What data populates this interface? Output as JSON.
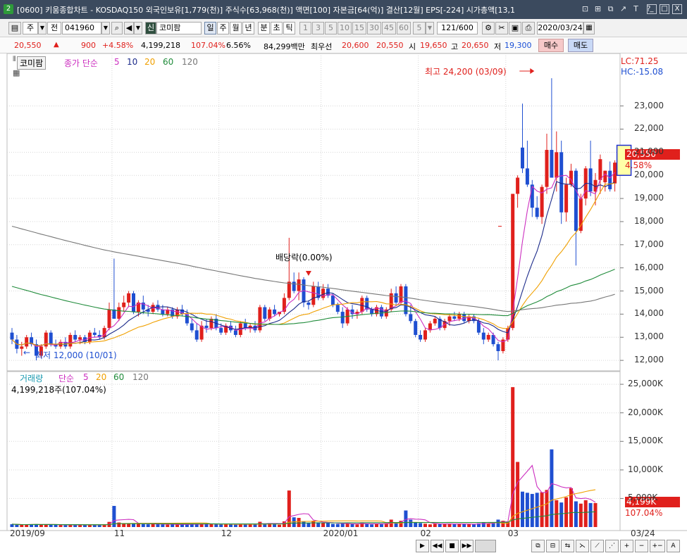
{
  "window": {
    "badge": "2",
    "title": "[0600] 키움종합차트 - KOSDAQ150 외국인보유[1,779(천)] 주식수[63,968(천)] 액면[100] 자본금[64(억)] 결산[12월] EPS[-224] 시가총액[13,1",
    "controls": [
      "⊡",
      "⊞",
      "⧉",
      "↗",
      "T",
      "?"
    ],
    "window_buttons": [
      "_",
      "□",
      "X"
    ]
  },
  "toolbar": {
    "period_unit": "주",
    "prev_label": "전",
    "code": "041960",
    "badge_sin": "신",
    "stock_name": "코미팜",
    "tabs": [
      "일",
      "주",
      "월",
      "년",
      "분",
      "초",
      "틱"
    ],
    "selected_tab": "일",
    "intervals": [
      "1",
      "3",
      "5",
      "10",
      "15",
      "30",
      "45",
      "60"
    ],
    "interval_value": "5",
    "count": "121/600",
    "date": "2020/03/24"
  },
  "infobar": {
    "price": "20,550",
    "change": "900",
    "change_pct": "+4.58%",
    "volume": "4,199,218",
    "volume_ratio": "107.04%",
    "turnover": "6.56%",
    "amount": "84,299백만",
    "best_quote_label": "최우선",
    "best_ask": "20,600",
    "best_bid": "20,550",
    "open_label": "시",
    "open": "19,650",
    "high_label": "고",
    "high": "20,650",
    "low_label": "저",
    "low": "19,300",
    "buy_button": "매수",
    "sell_button": "매도"
  },
  "legend": {
    "stock_tag": "코미팜",
    "price_label": "종가 단순",
    "ma": [
      "5",
      "10",
      "20",
      "60",
      "120"
    ],
    "volume_label": "거래량",
    "volume_ma_label": "단순",
    "vol_ma": [
      "5",
      "20",
      "60",
      "120"
    ],
    "volume_now": "4,199,218주(107.04%)"
  },
  "colors": {
    "up": "#e0201c",
    "down": "#1f4fd1",
    "ma5": "#cc2fc0",
    "ma10": "#1b2a8a",
    "ma20": "#f0a000",
    "ma60": "#1f8b3a",
    "ma120": "#777777",
    "ma_long": "#555555"
  },
  "annotations": {
    "high_note": "최고 24,200 (03/09)",
    "low_note": "최저 12,000 (10/01)",
    "dividend_note": "배당락(0.00%)",
    "lc": "LC:71.25",
    "hc": "HC:-15.08",
    "price_tag": "20,550",
    "pct_tag": "4.58%",
    "vol_tag": "4,199K",
    "vol_pct_tag": "107.04%"
  },
  "chart_data": {
    "type": "candlestick",
    "date_ticks": [
      "2019/09",
      "11",
      "12",
      "2020/01",
      "02",
      "03",
      "03/24"
    ],
    "price_axis": [
      "23,000",
      "22,000",
      "21,000",
      "20,000",
      "19,000",
      "18,000",
      "17,000",
      "16,000",
      "15,000",
      "14,000",
      "13,000",
      "12,000"
    ],
    "volume_axis": [
      "25,000K",
      "20,000K",
      "15,000K",
      "10,000K",
      "5,000K"
    ],
    "price_range": [
      11700,
      24600
    ],
    "volume_range": [
      0,
      26000
    ],
    "candles": [
      [
        13200,
        13400,
        12700,
        12900
      ],
      [
        12900,
        13100,
        12300,
        12500
      ],
      [
        12500,
        12800,
        12200,
        12600
      ],
      [
        12600,
        13100,
        12500,
        13000
      ],
      [
        13000,
        13200,
        12600,
        12700
      ],
      [
        12700,
        12900,
        12000,
        12200
      ],
      [
        12200,
        12700,
        12100,
        12600
      ],
      [
        12600,
        13300,
        12500,
        13200
      ],
      [
        13200,
        13300,
        12600,
        12700
      ],
      [
        12700,
        12900,
        12500,
        12600
      ],
      [
        12600,
        12900,
        12500,
        12800
      ],
      [
        12800,
        13000,
        12500,
        12600
      ],
      [
        12600,
        13200,
        12500,
        13100
      ],
      [
        13100,
        13300,
        12800,
        12900
      ],
      [
        12900,
        13100,
        12700,
        13000
      ],
      [
        13000,
        13100,
        12700,
        12800
      ],
      [
        12800,
        13300,
        12700,
        13200
      ],
      [
        13200,
        13400,
        13000,
        13100
      ],
      [
        13100,
        13300,
        12900,
        13000
      ],
      [
        13000,
        13500,
        12900,
        13400
      ],
      [
        13400,
        14500,
        13300,
        14200
      ],
      [
        14200,
        16400,
        13800,
        13800
      ],
      [
        13800,
        14500,
        13700,
        14300
      ],
      [
        14300,
        14800,
        14100,
        14500
      ],
      [
        14500,
        15000,
        14300,
        14900
      ],
      [
        14900,
        15000,
        14000,
        14100
      ],
      [
        14100,
        14600,
        13900,
        14500
      ],
      [
        14500,
        14800,
        14000,
        14200
      ],
      [
        14200,
        14400,
        13900,
        14100
      ],
      [
        14100,
        14500,
        14000,
        14400
      ],
      [
        14400,
        14600,
        14100,
        14200
      ],
      [
        14200,
        14400,
        13900,
        14000
      ],
      [
        14000,
        14300,
        13900,
        14200
      ],
      [
        14200,
        14300,
        13800,
        13900
      ],
      [
        13900,
        14300,
        13800,
        14200
      ],
      [
        14200,
        14400,
        13900,
        14000
      ],
      [
        14000,
        14200,
        13500,
        13600
      ],
      [
        13600,
        13800,
        13200,
        13300
      ],
      [
        13300,
        13600,
        12800,
        12900
      ],
      [
        12900,
        13700,
        12800,
        13500
      ],
      [
        13500,
        13800,
        13200,
        13400
      ],
      [
        13400,
        13900,
        13300,
        13800
      ],
      [
        13800,
        14000,
        13300,
        13400
      ],
      [
        13400,
        13600,
        13100,
        13200
      ],
      [
        13200,
        13600,
        13100,
        13500
      ],
      [
        13500,
        13700,
        13200,
        13300
      ],
      [
        13300,
        13500,
        13000,
        13100
      ],
      [
        13100,
        13700,
        13000,
        13600
      ],
      [
        13600,
        13800,
        13300,
        13400
      ],
      [
        13400,
        13600,
        13200,
        13500
      ],
      [
        13500,
        13700,
        13200,
        13300
      ],
      [
        13300,
        14400,
        13200,
        14300
      ],
      [
        14300,
        14400,
        13700,
        13800
      ],
      [
        13800,
        14300,
        13700,
        14200
      ],
      [
        14200,
        14400,
        13900,
        14000
      ],
      [
        14000,
        14100,
        13900,
        14100
      ],
      [
        14100,
        14900,
        14000,
        14700
      ],
      [
        14700,
        17300,
        14600,
        15400
      ],
      [
        15400,
        15800,
        14900,
        15000
      ],
      [
        15000,
        15800,
        14600,
        15500
      ],
      [
        15500,
        15600,
        14300,
        14500
      ],
      [
        14500,
        14600,
        14200,
        14400
      ],
      [
        14400,
        15400,
        14300,
        15200
      ],
      [
        15200,
        15400,
        14600,
        14700
      ],
      [
        14700,
        15300,
        14600,
        15100
      ],
      [
        15100,
        15300,
        14700,
        14800
      ],
      [
        14800,
        14900,
        14300,
        14400
      ],
      [
        14400,
        14500,
        14000,
        14100
      ],
      [
        14100,
        14300,
        13400,
        13600
      ],
      [
        13600,
        14300,
        13500,
        14200
      ],
      [
        14200,
        14400,
        13800,
        14000
      ],
      [
        14000,
        14200,
        13800,
        14100
      ],
      [
        14100,
        14800,
        14000,
        14700
      ],
      [
        14700,
        14800,
        14100,
        14200
      ],
      [
        14200,
        14300,
        13900,
        14000
      ],
      [
        14000,
        14400,
        13900,
        14300
      ],
      [
        14300,
        14400,
        13800,
        13900
      ],
      [
        13900,
        14300,
        13800,
        14200
      ],
      [
        14200,
        15100,
        14100,
        14900
      ],
      [
        14900,
        15200,
        14400,
        14500
      ],
      [
        14500,
        15300,
        14400,
        15200
      ],
      [
        15200,
        15300,
        13900,
        14000
      ],
      [
        14000,
        14400,
        13600,
        13700
      ],
      [
        13700,
        13800,
        13000,
        13100
      ],
      [
        13100,
        13300,
        12800,
        12900
      ],
      [
        12900,
        13400,
        12800,
        13300
      ],
      [
        13300,
        13700,
        13200,
        13600
      ],
      [
        13600,
        13900,
        13500,
        13800
      ],
      [
        13800,
        13900,
        13300,
        13400
      ],
      [
        13400,
        13800,
        13300,
        13700
      ],
      [
        13700,
        14000,
        13500,
        13900
      ],
      [
        13900,
        14100,
        13700,
        13800
      ],
      [
        13800,
        14100,
        13700,
        14000
      ],
      [
        14000,
        14100,
        13600,
        13700
      ],
      [
        13700,
        14000,
        13600,
        13900
      ],
      [
        13900,
        14000,
        13600,
        13700
      ],
      [
        13700,
        13800,
        13100,
        13200
      ],
      [
        13200,
        13400,
        12700,
        12900
      ],
      [
        12900,
        13200,
        12800,
        13100
      ],
      [
        13100,
        13200,
        12600,
        12700
      ],
      [
        12700,
        12800,
        12000,
        12400
      ],
      [
        12400,
        13000,
        12300,
        12900
      ],
      [
        12900,
        13500,
        12800,
        13400
      ],
      [
        13400,
        18000,
        13300,
        19200
      ],
      [
        19200,
        20000,
        18600,
        19900
      ],
      [
        21200,
        23100,
        20100,
        20300
      ],
      [
        20300,
        21500,
        19500,
        19600
      ],
      [
        19600,
        19800,
        18200,
        18600
      ],
      [
        18600,
        19100,
        18100,
        18200
      ],
      [
        18200,
        19600,
        17900,
        19500
      ],
      [
        19500,
        21800,
        19200,
        21100
      ],
      [
        21100,
        24200,
        20700,
        19900
      ],
      [
        19900,
        21900,
        19300,
        21000
      ],
      [
        21000,
        21500,
        17900,
        18400
      ],
      [
        18400,
        19900,
        18000,
        19600
      ],
      [
        19600,
        20500,
        19500,
        20200
      ],
      [
        20200,
        20300,
        16100,
        17600
      ],
      [
        17600,
        19200,
        17500,
        19000
      ],
      [
        19000,
        20400,
        18700,
        20300
      ],
      [
        20300,
        21500,
        19100,
        19300
      ],
      [
        19300,
        20100,
        18700,
        19800
      ],
      [
        19800,
        20900,
        19200,
        20700
      ],
      [
        19700,
        20200,
        19300,
        20200
      ],
      [
        20200,
        20600,
        19300,
        19400
      ],
      [
        19650,
        20650,
        19300,
        20550
      ]
    ],
    "volumes": [
      500,
      430,
      380,
      420,
      470,
      520,
      410,
      430,
      460,
      380,
      360,
      330,
      420,
      380,
      340,
      360,
      390,
      350,
      380,
      470,
      900,
      3700,
      800,
      620,
      680,
      640,
      560,
      520,
      480,
      600,
      500,
      460,
      420,
      470,
      440,
      500,
      480,
      520,
      460,
      600,
      550,
      580,
      520,
      470,
      510,
      440,
      410,
      560,
      470,
      530,
      450,
      920,
      500,
      690,
      560,
      410,
      1000,
      6400,
      1700,
      1600,
      1000,
      700,
      1100,
      820,
      750,
      680,
      560,
      540,
      680,
      560,
      500,
      460,
      820,
      580,
      460,
      520,
      480,
      660,
      1300,
      760,
      1100,
      2900,
      1300,
      830,
      690,
      580,
      470,
      560,
      520,
      560,
      620,
      480,
      520,
      510,
      540,
      480,
      660,
      780,
      560,
      820,
      1300,
      1100,
      850,
      24500,
      11400,
      6200,
      6000,
      5800,
      6000,
      6100,
      6500,
      13600,
      4700,
      4300,
      5200,
      6800,
      4500,
      4100,
      4700,
      4200,
      4199
    ],
    "box_candle": [
      20000,
      21300
    ]
  }
}
